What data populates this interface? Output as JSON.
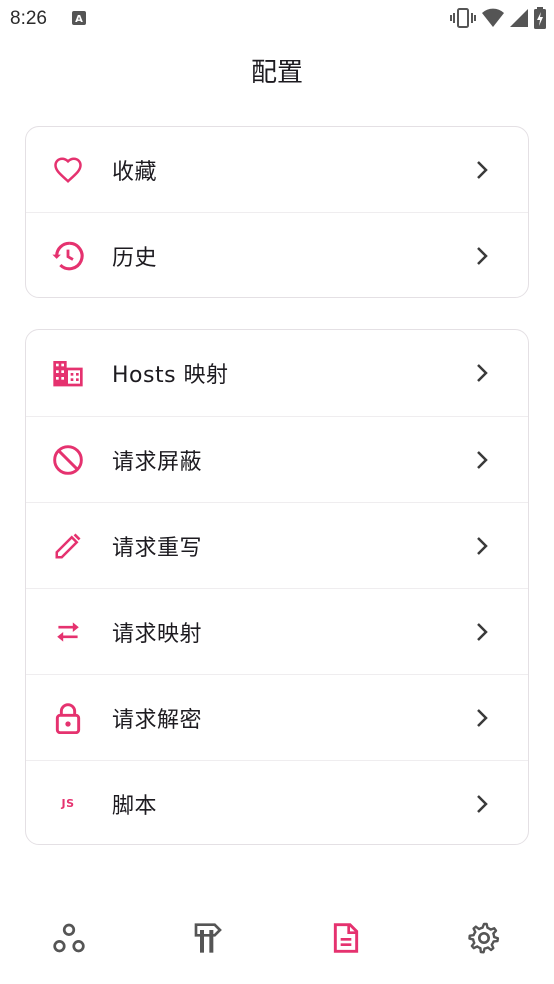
{
  "status_bar": {
    "time": "8:26"
  },
  "page": {
    "title": "配置"
  },
  "colors": {
    "accent": "#e5326f",
    "text": "#1d1b20",
    "nav_icon": "#555555"
  },
  "groups": [
    {
      "items": [
        {
          "label": "收藏",
          "icon": "heart-icon"
        },
        {
          "label": "历史",
          "icon": "history-icon"
        }
      ]
    },
    {
      "items": [
        {
          "label": "Hosts 映射",
          "icon": "hosts-icon"
        },
        {
          "label": "请求屏蔽",
          "icon": "block-icon"
        },
        {
          "label": "请求重写",
          "icon": "pencil-icon"
        },
        {
          "label": "请求映射",
          "icon": "swap-icon"
        },
        {
          "label": "请求解密",
          "icon": "lock-icon"
        },
        {
          "label": "脚本",
          "icon": "js-icon",
          "icon_text": "JS"
        }
      ]
    }
  ],
  "bottom_nav": [
    {
      "icon": "network-icon",
      "active": false
    },
    {
      "icon": "tools-icon",
      "active": false
    },
    {
      "icon": "document-icon",
      "active": true
    },
    {
      "icon": "settings-icon",
      "active": false
    }
  ]
}
